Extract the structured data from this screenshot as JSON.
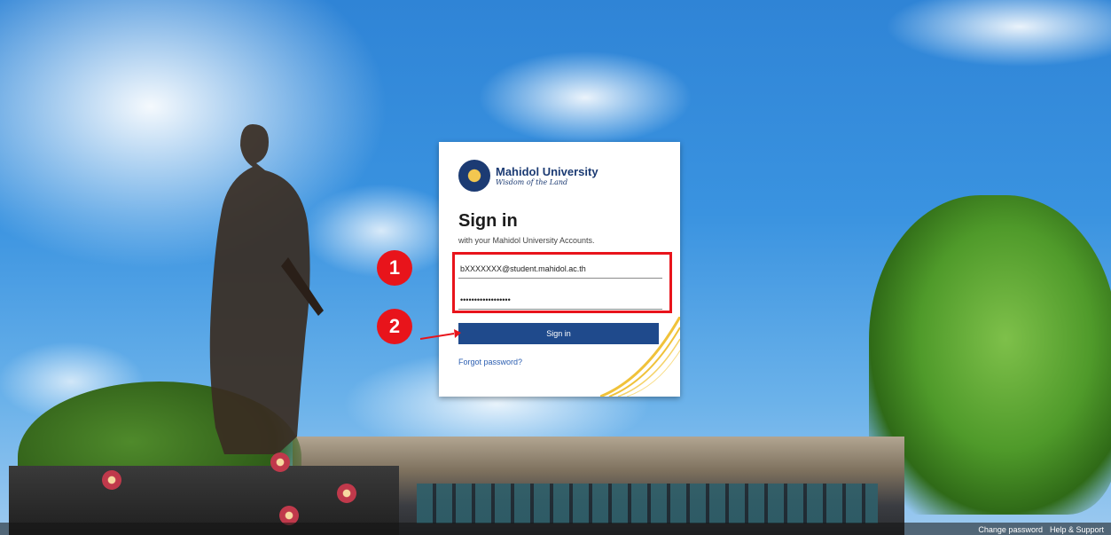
{
  "background": {
    "scene": "campus-statue-sky"
  },
  "login_card": {
    "brand_name": "Mahidol University",
    "brand_motto": "Wisdom of the Land",
    "title": "Sign in",
    "subtitle": "with your Mahidol University Accounts.",
    "email_value": "bXXXXXXX@student.mahidol.ac.th",
    "password_value": "••••••••••••••••••",
    "signin_label": "Sign in",
    "forgot_label": "Forgot password?",
    "colors": {
      "primary": "#1f4a8c",
      "link": "#2a5db0",
      "accent_swoosh": "#f0c23a"
    }
  },
  "annotations": {
    "step1": "1",
    "step2": "2",
    "highlight_color": "#e8141b"
  },
  "footer": {
    "change_password": "Change password",
    "help": "Help & Support"
  },
  "icons": {
    "logo": "mahidol-seal-icon",
    "arrow": "arrow-right-icon"
  }
}
